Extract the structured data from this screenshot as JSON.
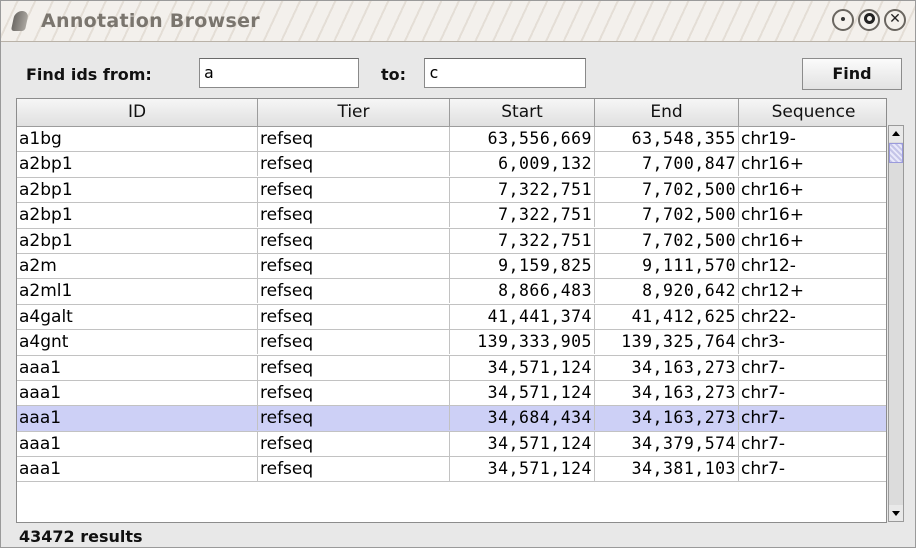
{
  "window": {
    "title": "Annotation Browser"
  },
  "find_bar": {
    "from_label": "Find ids from:",
    "from_value": "a",
    "to_label": "to:",
    "to_value": "c",
    "find_button": "Find"
  },
  "table": {
    "columns": [
      "ID",
      "Tier",
      "Start",
      "End",
      "Sequence"
    ],
    "rows": [
      {
        "id": "a1bg",
        "tier": "refseq",
        "start": "63,556,669",
        "end": "63,548,355",
        "seq": "chr19-",
        "selected": false
      },
      {
        "id": "a2bp1",
        "tier": "refseq",
        "start": "6,009,132",
        "end": "7,700,847",
        "seq": "chr16+",
        "selected": false
      },
      {
        "id": "a2bp1",
        "tier": "refseq",
        "start": "7,322,751",
        "end": "7,702,500",
        "seq": "chr16+",
        "selected": false
      },
      {
        "id": "a2bp1",
        "tier": "refseq",
        "start": "7,322,751",
        "end": "7,702,500",
        "seq": "chr16+",
        "selected": false
      },
      {
        "id": "a2bp1",
        "tier": "refseq",
        "start": "7,322,751",
        "end": "7,702,500",
        "seq": "chr16+",
        "selected": false
      },
      {
        "id": "a2m",
        "tier": "refseq",
        "start": "9,159,825",
        "end": "9,111,570",
        "seq": "chr12-",
        "selected": false
      },
      {
        "id": "a2ml1",
        "tier": "refseq",
        "start": "8,866,483",
        "end": "8,920,642",
        "seq": "chr12+",
        "selected": false
      },
      {
        "id": "a4galt",
        "tier": "refseq",
        "start": "41,441,374",
        "end": "41,412,625",
        "seq": "chr22-",
        "selected": false
      },
      {
        "id": "a4gnt",
        "tier": "refseq",
        "start": "139,333,905",
        "end": "139,325,764",
        "seq": "chr3-",
        "selected": false
      },
      {
        "id": "aaa1",
        "tier": "refseq",
        "start": "34,571,124",
        "end": "34,163,273",
        "seq": "chr7-",
        "selected": false
      },
      {
        "id": "aaa1",
        "tier": "refseq",
        "start": "34,571,124",
        "end": "34,163,273",
        "seq": "chr7-",
        "selected": false
      },
      {
        "id": "aaa1",
        "tier": "refseq",
        "start": "34,684,434",
        "end": "34,163,273",
        "seq": "chr7-",
        "selected": true
      },
      {
        "id": "aaa1",
        "tier": "refseq",
        "start": "34,571,124",
        "end": "34,379,574",
        "seq": "chr7-",
        "selected": false
      },
      {
        "id": "aaa1",
        "tier": "refseq",
        "start": "34,571,124",
        "end": "34,381,103",
        "seq": "chr7-",
        "selected": false
      }
    ]
  },
  "status": {
    "results": "43472 results"
  },
  "colors": {
    "selection": "#cdd0f6",
    "window_bg": "#e8e8e8"
  },
  "icons": {
    "window_menu": "window-menu-icon",
    "minimize": "minimize-icon",
    "maximize": "maximize-icon",
    "close": "close-icon"
  }
}
